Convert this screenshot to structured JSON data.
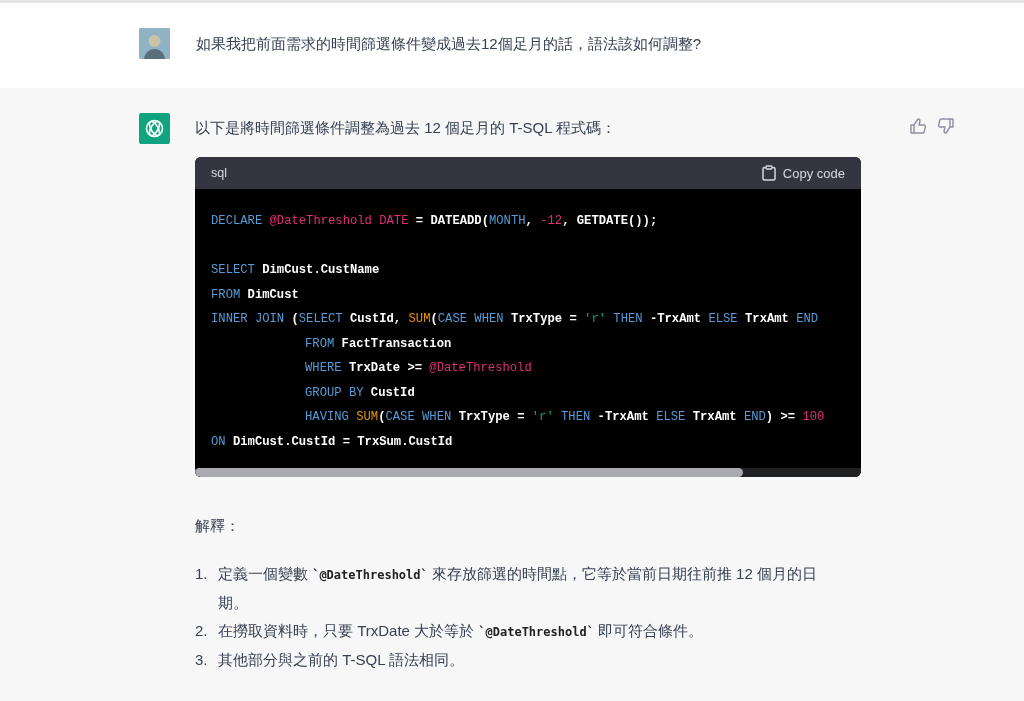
{
  "user_message": {
    "text": "如果我把前面需求的時間篩選條件變成過去12個足月的話，語法該如何調整?"
  },
  "assistant_message": {
    "intro": "以下是將時間篩選條件調整為過去 12 個足月的 T-SQL 程式碼：",
    "code_block": {
      "language": "sql",
      "copy_label": "Copy code",
      "lines": [
        {
          "kind": "code",
          "indented": false,
          "tokens": [
            {
              "text": "DECLARE",
              "kind": "keyword"
            },
            {
              "text": " @DateThreshold",
              "kind": "variable"
            },
            {
              "text": " DATE",
              "kind": "variable"
            },
            {
              "text": " = DATEADD(",
              "kind": "plain"
            },
            {
              "text": "MONTH",
              "kind": "keyword"
            },
            {
              "text": ", ",
              "kind": "plain"
            },
            {
              "text": "-12",
              "kind": "number"
            },
            {
              "text": ", GETDATE());",
              "kind": "plain"
            }
          ]
        },
        {
          "kind": "blank"
        },
        {
          "kind": "code",
          "indented": false,
          "tokens": [
            {
              "text": "SELECT",
              "kind": "keyword"
            },
            {
              "text": " DimCust.CustName",
              "kind": "plain"
            }
          ]
        },
        {
          "kind": "code",
          "indented": false,
          "tokens": [
            {
              "text": "FROM",
              "kind": "keyword"
            },
            {
              "text": " DimCust",
              "kind": "plain"
            }
          ]
        },
        {
          "kind": "code",
          "indented": false,
          "tokens": [
            {
              "text": "INNER JOIN",
              "kind": "keyword"
            },
            {
              "text": " (",
              "kind": "plain"
            },
            {
              "text": "SELECT",
              "kind": "keyword"
            },
            {
              "text": " CustId, ",
              "kind": "plain"
            },
            {
              "text": "SUM",
              "kind": "function"
            },
            {
              "text": "(",
              "kind": "plain"
            },
            {
              "text": "CASE WHEN",
              "kind": "keyword"
            },
            {
              "text": " TrxType = ",
              "kind": "plain"
            },
            {
              "text": "'r'",
              "kind": "string"
            },
            {
              "text": " THEN",
              "kind": "keyword"
            },
            {
              "text": " -TrxAmt ",
              "kind": "plain"
            },
            {
              "text": "ELSE",
              "kind": "keyword"
            },
            {
              "text": " TrxAmt ",
              "kind": "plain"
            },
            {
              "text": "END",
              "kind": "keyword"
            }
          ]
        },
        {
          "kind": "code",
          "indented": true,
          "tokens": [
            {
              "text": "FROM",
              "kind": "keyword"
            },
            {
              "text": " FactTransaction",
              "kind": "plain"
            }
          ]
        },
        {
          "kind": "code",
          "indented": true,
          "tokens": [
            {
              "text": "WHERE",
              "kind": "keyword"
            },
            {
              "text": " TrxDate >= ",
              "kind": "plain"
            },
            {
              "text": "@DateThreshold",
              "kind": "variable"
            }
          ]
        },
        {
          "kind": "code",
          "indented": true,
          "tokens": [
            {
              "text": "GROUP BY",
              "kind": "keyword"
            },
            {
              "text": " CustId",
              "kind": "plain"
            }
          ]
        },
        {
          "kind": "code",
          "indented": true,
          "tokens": [
            {
              "text": "HAVING",
              "kind": "keyword"
            },
            {
              "text": " SUM",
              "kind": "function"
            },
            {
              "text": "(",
              "kind": "plain"
            },
            {
              "text": "CASE WHEN",
              "kind": "keyword"
            },
            {
              "text": " TrxType = ",
              "kind": "plain"
            },
            {
              "text": "'r'",
              "kind": "string"
            },
            {
              "text": " THEN",
              "kind": "keyword"
            },
            {
              "text": " -TrxAmt ",
              "kind": "plain"
            },
            {
              "text": "ELSE",
              "kind": "keyword"
            },
            {
              "text": " TrxAmt ",
              "kind": "plain"
            },
            {
              "text": "END",
              "kind": "keyword"
            },
            {
              "text": ") >= ",
              "kind": "plain"
            },
            {
              "text": "100",
              "kind": "number"
            }
          ]
        },
        {
          "kind": "code",
          "indented": false,
          "tokens": [
            {
              "text": "ON",
              "kind": "keyword"
            },
            {
              "text": " DimCust.CustId = TrxSum.CustId",
              "kind": "plain"
            }
          ]
        }
      ]
    },
    "explanation_heading": "解釋：",
    "explanation_items": [
      {
        "number": "1.",
        "parts": [
          {
            "text": "定義一個變數 ",
            "kind": "text"
          },
          {
            "text": "`@DateThreshold`",
            "kind": "code"
          },
          {
            "text": " 來存放篩選的時間點，它等於當前日期往前推 12 個月的日期。",
            "kind": "text"
          }
        ]
      },
      {
        "number": "2.",
        "parts": [
          {
            "text": "在撈取資料時，只要 TrxDate 大於等於 ",
            "kind": "text"
          },
          {
            "text": "`@DateThreshold`",
            "kind": "code"
          },
          {
            "text": " 即可符合條件。",
            "kind": "text"
          }
        ]
      },
      {
        "number": "3.",
        "parts": [
          {
            "text": "其他部分與之前的 T-SQL 語法相同。",
            "kind": "text"
          }
        ]
      }
    ]
  }
}
